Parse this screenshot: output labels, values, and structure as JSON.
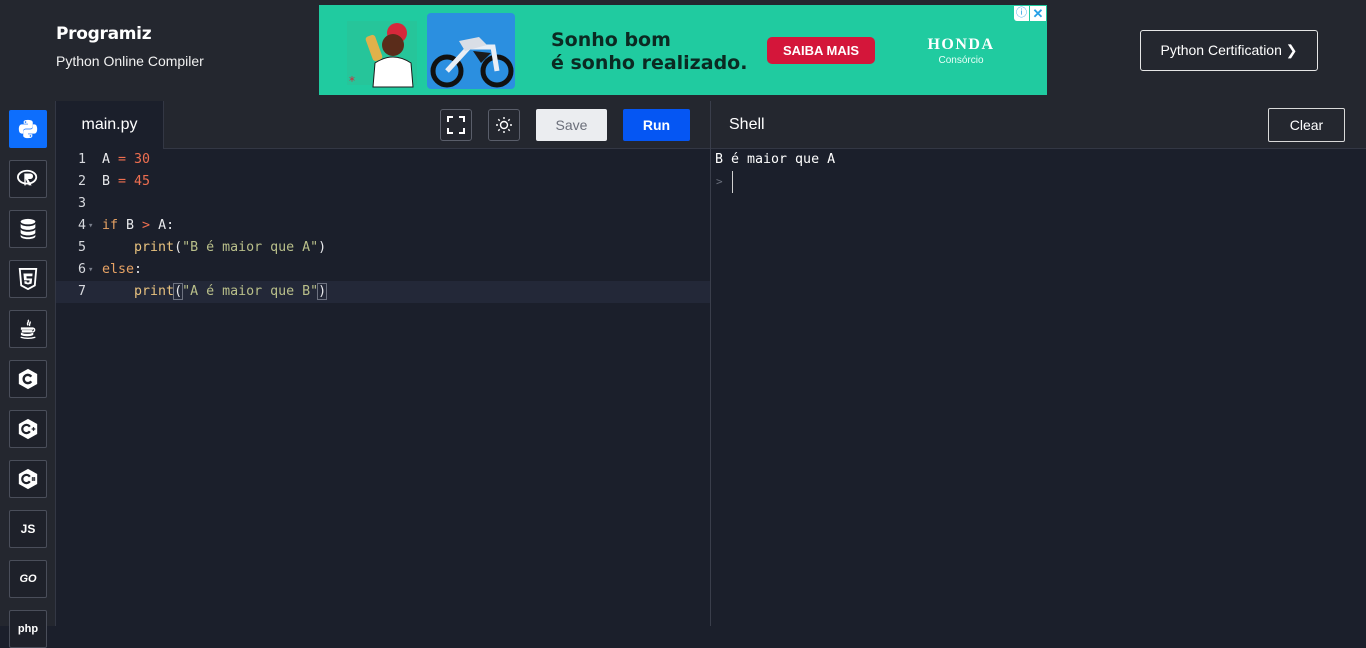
{
  "header": {
    "logo": "Programiz",
    "subtitle": "Python Online Compiler",
    "cert_button": "Python Certification ❯"
  },
  "ad": {
    "headline_line1": "Sonho bom",
    "headline_line2": "é sonho realizado.",
    "cta": "SAIBA MAIS",
    "brand": "HONDA",
    "brand_sub": "Consórcio",
    "info_icon": "ⓘ",
    "close_icon": "✕",
    "background": "#20cba0"
  },
  "sidebar": {
    "languages": [
      {
        "name": "python",
        "icon": "python-icon",
        "active": true
      },
      {
        "name": "r",
        "icon": "r-icon"
      },
      {
        "name": "sql",
        "icon": "database-icon"
      },
      {
        "name": "html",
        "icon": "html5-icon"
      },
      {
        "name": "java",
        "icon": "java-icon"
      },
      {
        "name": "c",
        "icon": "c-icon"
      },
      {
        "name": "cpp",
        "icon": "cpp-icon"
      },
      {
        "name": "csharp",
        "icon": "csharp-icon"
      },
      {
        "name": "javascript",
        "label": "JS"
      },
      {
        "name": "go",
        "label": "GO"
      },
      {
        "name": "php",
        "label": "php"
      }
    ]
  },
  "editor": {
    "filename": "main.py",
    "save_label": "Save",
    "run_label": "Run",
    "run_color": "#0556f3",
    "lines": [
      {
        "n": "1",
        "tokens": [
          [
            "t",
            "A "
          ],
          [
            "op",
            "="
          ],
          [
            "t",
            " "
          ],
          [
            "num",
            "30"
          ]
        ]
      },
      {
        "n": "2",
        "tokens": [
          [
            "t",
            "B "
          ],
          [
            "op",
            "="
          ],
          [
            "t",
            " "
          ],
          [
            "num",
            "45"
          ]
        ]
      },
      {
        "n": "3",
        "tokens": []
      },
      {
        "n": "4",
        "fold": true,
        "tokens": [
          [
            "kw",
            "if"
          ],
          [
            "t",
            " B "
          ],
          [
            "op",
            ">"
          ],
          [
            "t",
            " A:"
          ]
        ]
      },
      {
        "n": "5",
        "tokens": [
          [
            "t",
            "    "
          ],
          [
            "fn",
            "print"
          ],
          [
            "t",
            "("
          ],
          [
            "str",
            "\"B é maior que A\""
          ],
          [
            "t",
            ")"
          ]
        ]
      },
      {
        "n": "6",
        "fold": true,
        "tokens": [
          [
            "kw",
            "else"
          ],
          [
            "t",
            ":"
          ]
        ]
      },
      {
        "n": "7",
        "current": true,
        "tokens": [
          [
            "t",
            "    "
          ],
          [
            "fn",
            "print"
          ],
          [
            "hl",
            "("
          ],
          [
            "str",
            "\"A é maior que B\""
          ],
          [
            "hl",
            ")"
          ]
        ]
      }
    ]
  },
  "shell": {
    "title": "Shell",
    "clear_label": "Clear",
    "output": "B é maior que A",
    "prompt": ">"
  }
}
